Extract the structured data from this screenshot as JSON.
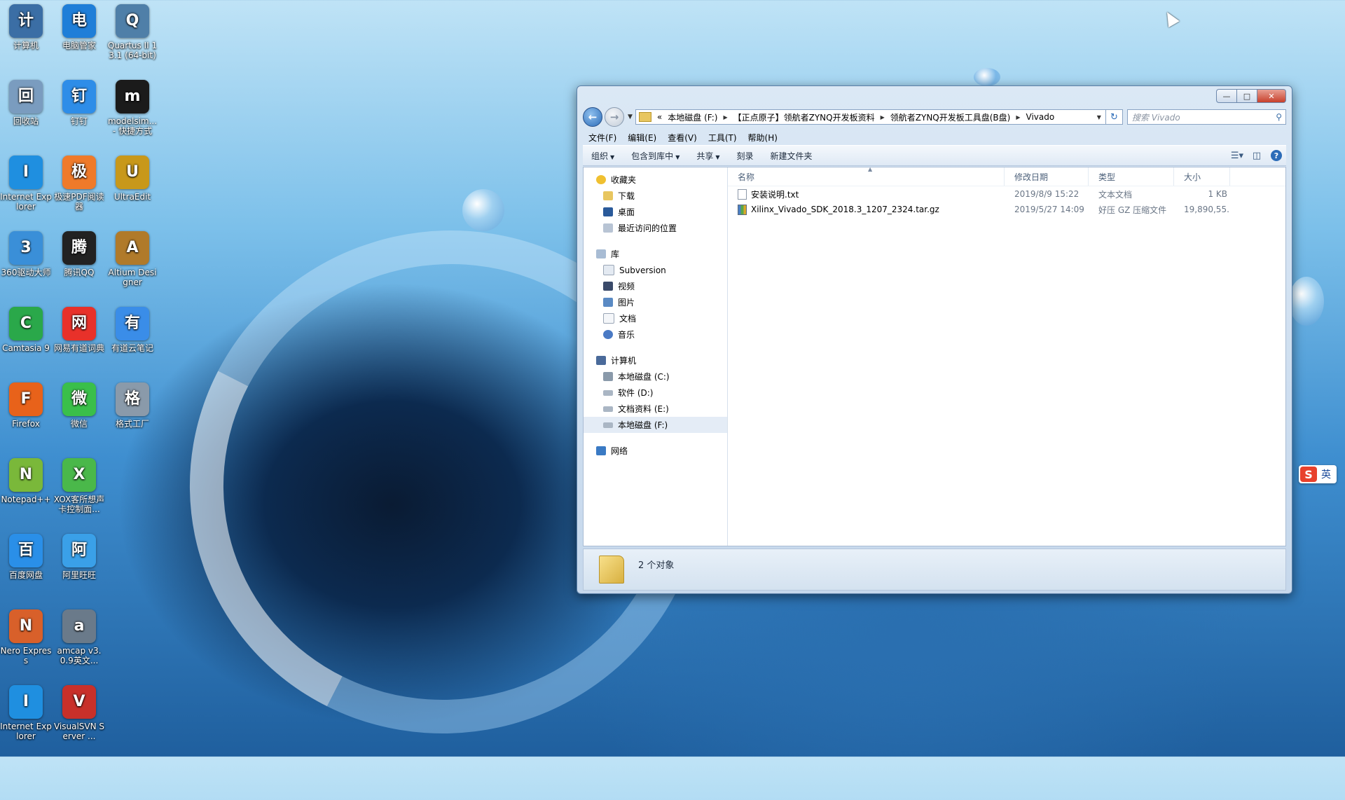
{
  "colors": {
    "window_bg": "#dbe8f5",
    "selection": "#e4ecf6",
    "close_button": "#c8402c"
  },
  "desktop": {
    "icons": [
      {
        "label": "计算机",
        "icon": "computer-icon",
        "color": "#3b6ea5"
      },
      {
        "label": "电脑管家",
        "icon": "shield-icon",
        "color": "#1f7ed8"
      },
      {
        "label": "Quartus II 13.1 (64-bit)",
        "icon": "quartus-icon",
        "color": "#4f7fa8"
      },
      {
        "label": "回收站",
        "icon": "recycle-bin-icon",
        "color": "#7a9cbf"
      },
      {
        "label": "钉钉",
        "icon": "dingtalk-icon",
        "color": "#2e8de8"
      },
      {
        "label": "modelsim... - 快捷方式",
        "icon": "modelsim-icon",
        "color": "#1b1b1b"
      },
      {
        "label": "Internet Explorer",
        "icon": "ie-icon",
        "color": "#1f8fe0"
      },
      {
        "label": "极速PDF阅读器",
        "icon": "pdf-icon",
        "color": "#ef7a2a"
      },
      {
        "label": "UltraEdit",
        "icon": "ultraedit-icon",
        "color": "#c8981a"
      },
      {
        "label": "360驱动大师",
        "icon": "driver-icon",
        "color": "#3a8fd8"
      },
      {
        "label": "腾讯QQ",
        "icon": "qq-icon",
        "color": "#222"
      },
      {
        "label": "Altium Designer",
        "icon": "altium-icon",
        "color": "#b07a2a"
      },
      {
        "label": "Camtasia 9",
        "icon": "camtasia-icon",
        "color": "#2aa84a"
      },
      {
        "label": "网易有道词典",
        "icon": "youdao-dict-icon",
        "color": "#e8312a"
      },
      {
        "label": "有道云笔记",
        "icon": "youdao-note-icon",
        "color": "#3a8de8"
      },
      {
        "label": "Firefox",
        "icon": "firefox-icon",
        "color": "#e8621a"
      },
      {
        "label": "微信",
        "icon": "wechat-icon",
        "color": "#3abf4a"
      },
      {
        "label": "格式工厂",
        "icon": "format-factory-icon",
        "color": "#8a9aaa"
      },
      {
        "label": "Notepad++",
        "icon": "notepadpp-icon",
        "color": "#7ab83a"
      },
      {
        "label": "XOX客所想声卡控制面...",
        "icon": "xox-icon",
        "color": "#4ab84a"
      },
      {
        "label": "",
        "icon": "",
        "color": ""
      },
      {
        "label": "百度网盘",
        "icon": "baidu-pan-icon",
        "color": "#2a8fe8"
      },
      {
        "label": "阿里旺旺",
        "icon": "aliwangwang-icon",
        "color": "#3aa0e8"
      },
      {
        "label": "",
        "icon": "",
        "color": ""
      },
      {
        "label": "Nero Express",
        "icon": "nero-icon",
        "color": "#d8602a"
      },
      {
        "label": "amcap v3.0.9英文...",
        "icon": "amcap-icon",
        "color": "#6a7a8a"
      },
      {
        "label": "",
        "icon": "",
        "color": ""
      },
      {
        "label": "Internet Explorer",
        "icon": "ie-icon",
        "color": "#1f8fe0"
      },
      {
        "label": "VisualSVN Server ...",
        "icon": "visualsvn-icon",
        "color": "#c8302a"
      }
    ]
  },
  "window": {
    "address": {
      "prefix": "«",
      "crumbs": [
        "本地磁盘 (F:)",
        "【正点原子】领航者ZYNQ开发板资料",
        "领航者ZYNQ开发板工具盘(B盘)",
        "Vivado"
      ],
      "search_placeholder": "搜索 Vivado"
    },
    "menu": [
      "文件(F)",
      "编辑(E)",
      "查看(V)",
      "工具(T)",
      "帮助(H)"
    ],
    "toolbar": {
      "organize": "组织",
      "include_library": "包含到库中",
      "share": "共享",
      "burn": "刻录",
      "new_folder": "新建文件夹"
    },
    "nav": {
      "favorites": "收藏夹",
      "fav_items": [
        "下载",
        "桌面",
        "最近访问的位置"
      ],
      "libraries": "库",
      "lib_items": [
        "Subversion",
        "视频",
        "图片",
        "文档",
        "音乐"
      ],
      "computer": "计算机",
      "drives": [
        "本地磁盘 (C:)",
        "软件 (D:)",
        "文档资料 (E:)",
        "本地磁盘 (F:)"
      ],
      "network": "网络"
    },
    "columns": {
      "name": "名称",
      "date": "修改日期",
      "type": "类型",
      "size": "大小"
    },
    "files": [
      {
        "name": "安装说明.txt",
        "date": "2019/8/9 15:22",
        "type": "文本文档",
        "size": "1 KB"
      },
      {
        "name": "Xilinx_Vivado_SDK_2018.3_1207_2324.tar.gz",
        "date": "2019/5/27 14:09",
        "type": "好压 GZ 压缩文件",
        "size": "19,890,55..."
      }
    ],
    "status": "2 个对象"
  },
  "ime": {
    "logo": "S",
    "mode": "英"
  }
}
